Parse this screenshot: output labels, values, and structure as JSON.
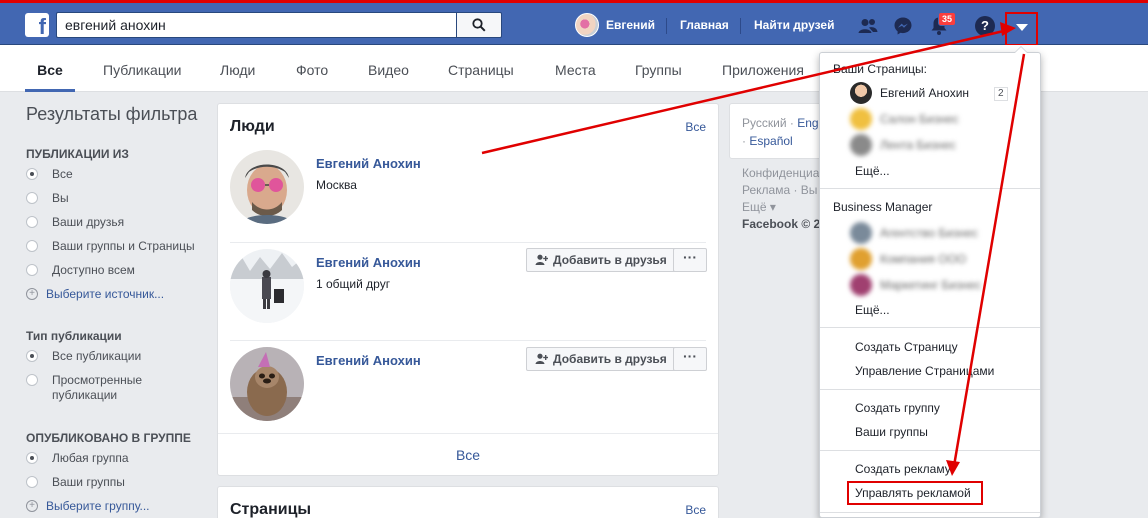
{
  "topbar": {
    "logo_letter": "f",
    "search_value": "евгений анохин",
    "user_name": "Евгений",
    "home_label": "Главная",
    "find_friends_label": "Найти друзей",
    "notifications_count": "35",
    "help_glyph": "?",
    "icons": [
      "search-icon",
      "friend-requests-icon",
      "messenger-icon",
      "notifications-icon",
      "help-icon",
      "account-menu-icon"
    ],
    "accent_color": "#4267b2"
  },
  "tabs": [
    "Все",
    "Публикации",
    "Люди",
    "Фото",
    "Видео",
    "Страницы",
    "Места",
    "Группы",
    "Приложения"
  ],
  "filters": {
    "title": "Результаты фильтра",
    "groups": [
      {
        "title": "ПУБЛИКАЦИИ ИЗ",
        "options": [
          "Все",
          "Вы",
          "Ваши друзья",
          "Ваши группы и Страницы",
          "Доступно всем"
        ],
        "link": "Выберите источник..."
      },
      {
        "title": "Тип публикации",
        "options": [
          "Все публикации",
          "Просмотренные публикации"
        ]
      },
      {
        "title": "ОПУБЛИКОВАНО В ГРУППЕ",
        "options": [
          "Любая группа",
          "Ваши группы"
        ],
        "link": "Выберите группу..."
      }
    ]
  },
  "people": {
    "title": "Люди",
    "see_all": "Все",
    "bottom_see_all": "Все",
    "add_friend_label": "Добавить в друзья",
    "more_label": "···",
    "results": [
      {
        "name": "Евгений Анохин",
        "sub": "Москва"
      },
      {
        "name": "Евгений Анохин",
        "sub": "1 общий друг"
      },
      {
        "name": "Евгений Анохин",
        "sub": ""
      }
    ]
  },
  "pages": {
    "title": "Страницы",
    "see_all": "Все"
  },
  "languages": {
    "current": "Русский",
    "sep": "·",
    "english": "Engl",
    "spanish": "Español"
  },
  "footer": {
    "line1": "Конфиденциа",
    "line2": "Реклама · Вы",
    "line3": "Ещё ▾",
    "line4": "Facebook © 20"
  },
  "dropdown": {
    "your_pages_title": "Ваши Страницы:",
    "page_main": "Евгений Анохин",
    "page_main_count": "2",
    "page_blur_1": "Салон Бизнес",
    "page_blur_2": "Лента Бизнес",
    "pages_more": "Ещё...",
    "bm_title": "Business Manager",
    "bm_blur_1": "Агентство Бизнес",
    "bm_blur_2": "Компания ООО",
    "bm_blur_3": "Маркетинг Бизнес",
    "bm_more": "Ещё...",
    "create_page": "Создать Страницу",
    "manage_pages": "Управление Страницами",
    "create_group": "Создать группу",
    "your_groups": "Ваши группы",
    "create_ad": "Создать рекламу",
    "manage_ads": "Управлять рекламой"
  },
  "annotation_color": "#e00000"
}
